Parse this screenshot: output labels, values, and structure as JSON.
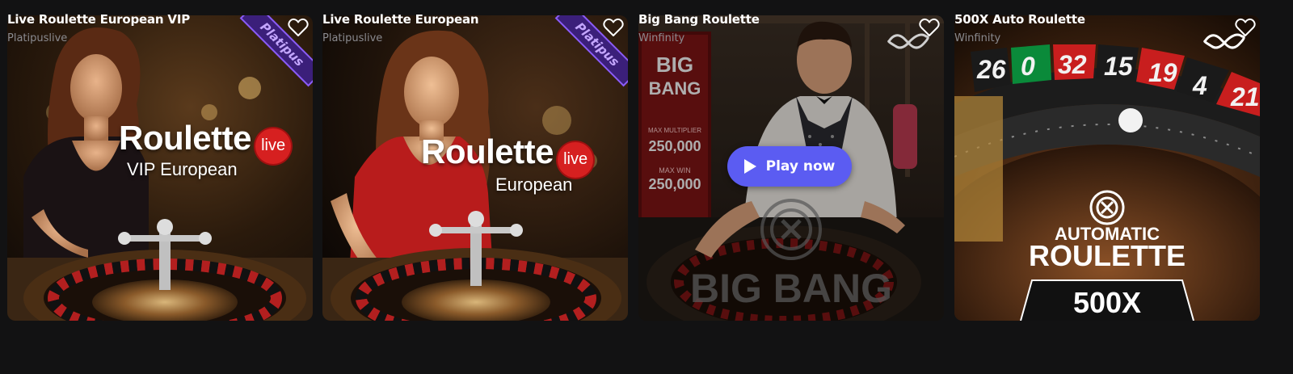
{
  "games": [
    {
      "title": "Live Roulette European VIP",
      "provider": "Platipuslive",
      "art": {
        "brand": "Roulette",
        "live": "live",
        "sub": "VIP European",
        "badge": "Platipus"
      }
    },
    {
      "title": "Live Roulette European",
      "provider": "Platipuslive",
      "art": {
        "brand": "Roulette",
        "live": "live",
        "sub": "European",
        "badge": "Platipus"
      }
    },
    {
      "title": "Big Bang Roulette",
      "provider": "Winfinity",
      "art": {
        "sign_big": "BIG",
        "sign_bang": "BANG",
        "sign_max_multiplier": "MAX MULTIPLIER",
        "sign_val1": "250,000",
        "sign_max_win": "MAX WIN",
        "sign_val2": "250,000",
        "logo_text": "BIG BANG"
      },
      "play_label": "Play now"
    },
    {
      "title": "500X Auto Roulette",
      "provider": "Winfinity",
      "art": {
        "line1": "AUTOMATIC",
        "line2": "ROULETTE",
        "line3": "500X",
        "wheel_numbers": [
          "26",
          "0",
          "32",
          "15",
          "19",
          "4",
          "21"
        ]
      }
    }
  ],
  "colors": {
    "background": "#121213",
    "play_button": "#5b5cf2",
    "provider_text": "#8a8a8f",
    "badge": "#8b5cf6",
    "live_badge": "#d62020"
  }
}
